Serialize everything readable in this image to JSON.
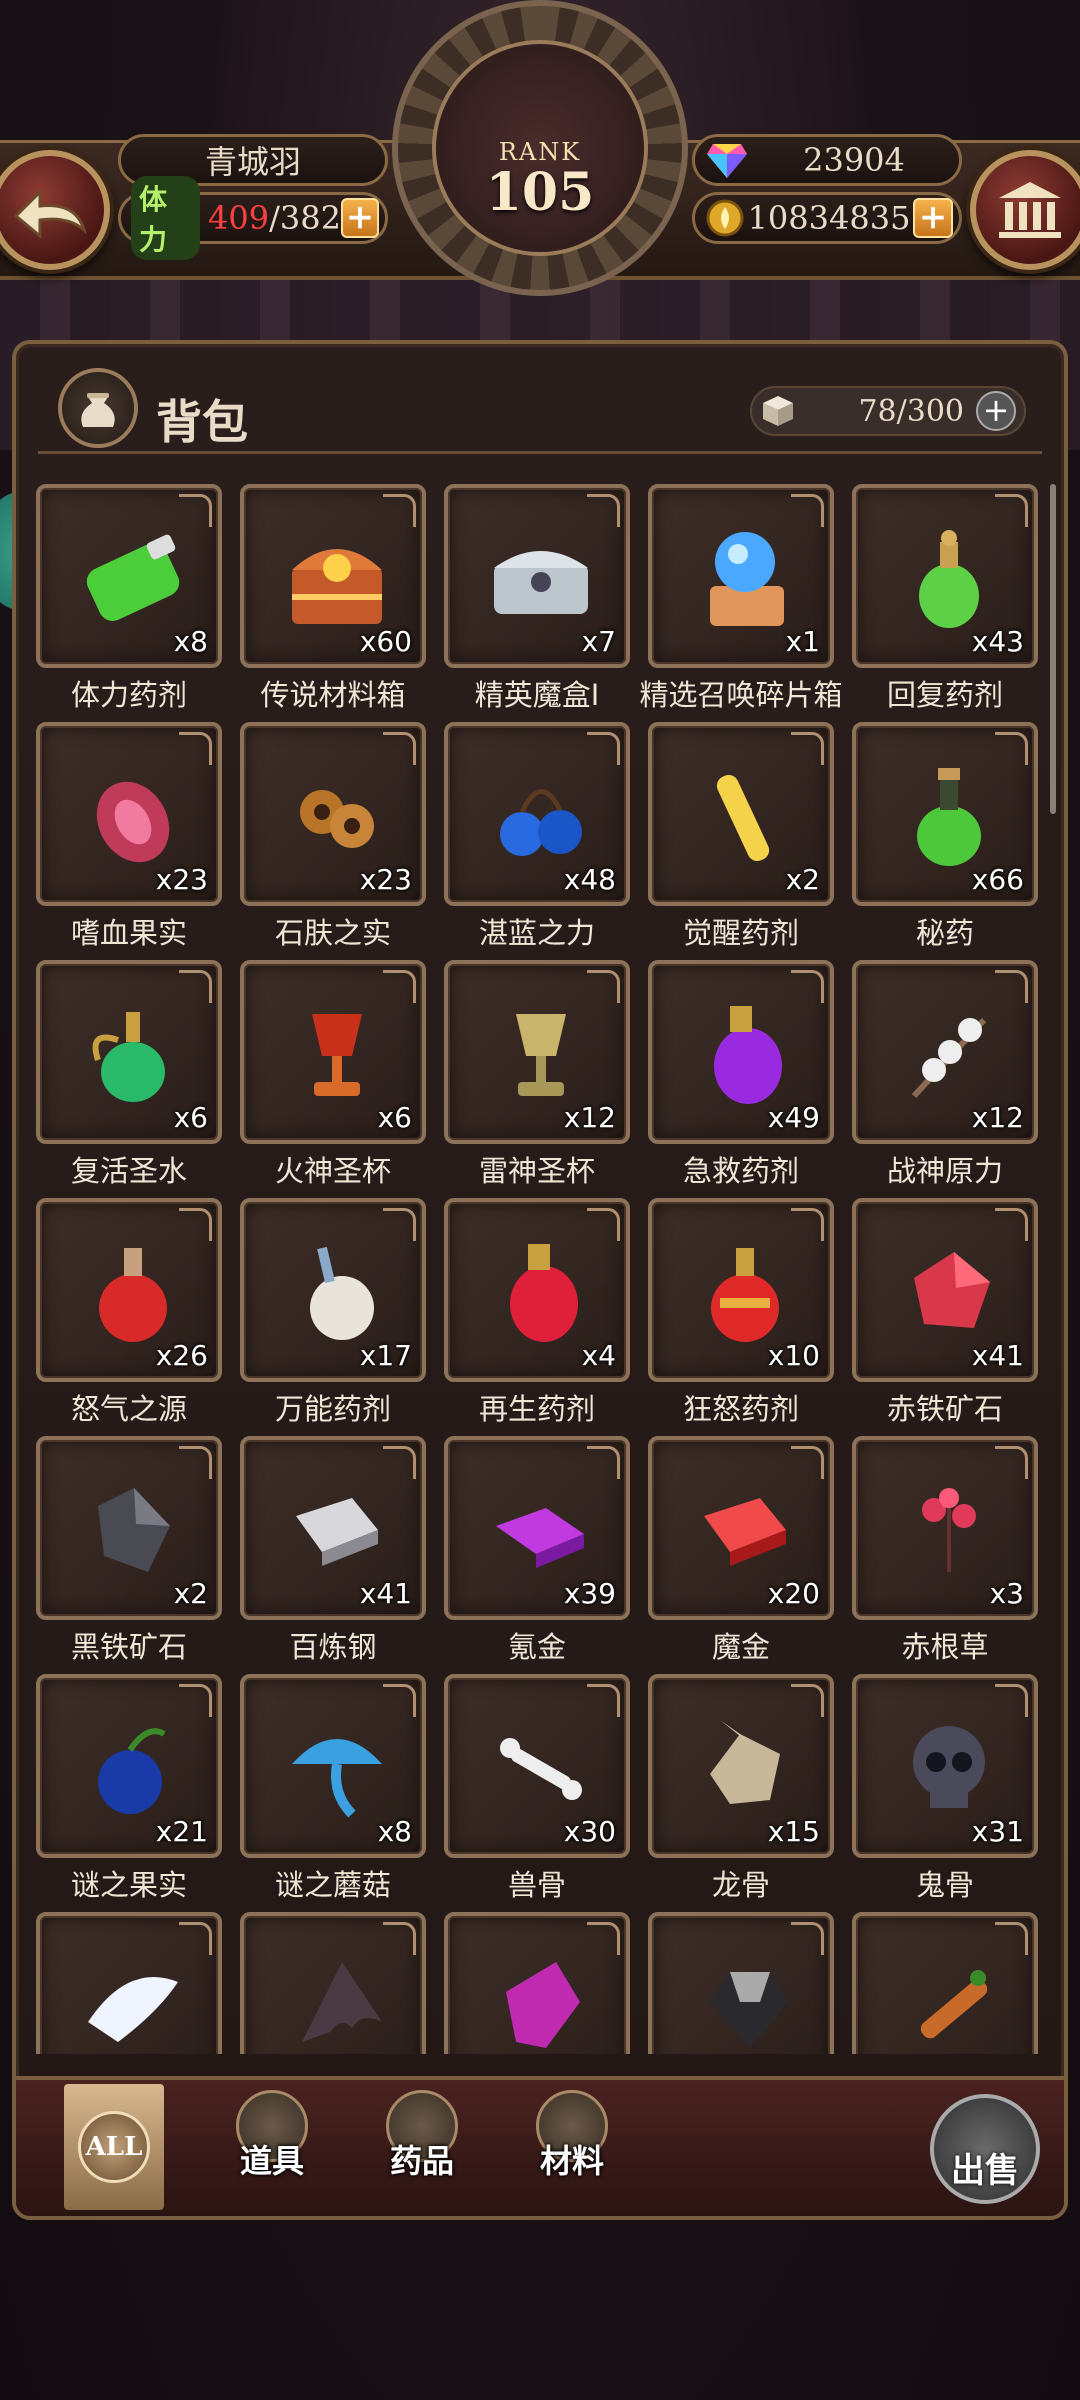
{
  "hud": {
    "player_name": "青城羽",
    "stamina_label": "体力",
    "stamina_current": "409",
    "stamina_max": "/382",
    "gems": "23904",
    "gold": "10834835",
    "rank_label": "RANK",
    "rank_value": "105"
  },
  "panel": {
    "title": "背包",
    "capacity": "78/300"
  },
  "items": [
    {
      "name": "体力药剂",
      "qty": "x8",
      "icon": "green-potion-bottle-icon"
    },
    {
      "name": "传说材料箱",
      "qty": "x60",
      "icon": "legendary-chest-icon"
    },
    {
      "name": "精英魔盒Ⅰ",
      "qty": "x7",
      "icon": "silver-chest-icon"
    },
    {
      "name": "精选召唤碎片箱",
      "qty": "x1",
      "icon": "summon-crystal-chest-icon"
    },
    {
      "name": "回复药剂",
      "qty": "x43",
      "icon": "green-vial-icon"
    },
    {
      "name": "嗜血果实",
      "qty": "x23",
      "icon": "blood-fruit-icon"
    },
    {
      "name": "石肤之实",
      "qty": "x23",
      "icon": "stone-nut-icon"
    },
    {
      "name": "湛蓝之力",
      "qty": "x48",
      "icon": "blue-berries-icon"
    },
    {
      "name": "觉醒药剂",
      "qty": "x2",
      "icon": "yellow-tube-icon"
    },
    {
      "name": "秘药",
      "qty": "x66",
      "icon": "green-flask-icon"
    },
    {
      "name": "复活圣水",
      "qty": "x6",
      "icon": "holy-water-icon"
    },
    {
      "name": "火神圣杯",
      "qty": "x6",
      "icon": "fire-chalice-icon"
    },
    {
      "name": "雷神圣杯",
      "qty": "x12",
      "icon": "thunder-chalice-icon"
    },
    {
      "name": "急救药剂",
      "qty": "x49",
      "icon": "purple-potion-icon"
    },
    {
      "name": "战神原力",
      "qty": "x12",
      "icon": "cotton-branch-icon"
    },
    {
      "name": "怒气之源",
      "qty": "x26",
      "icon": "red-round-flask-icon"
    },
    {
      "name": "万能药剂",
      "qty": "x17",
      "icon": "white-potion-icon"
    },
    {
      "name": "再生药剂",
      "qty": "x4",
      "icon": "red-potion-icon"
    },
    {
      "name": "狂怒药剂",
      "qty": "x10",
      "icon": "red-gold-flask-icon"
    },
    {
      "name": "赤铁矿石",
      "qty": "x41",
      "icon": "red-ore-icon"
    },
    {
      "name": "黑铁矿石",
      "qty": "x2",
      "icon": "black-ore-icon"
    },
    {
      "name": "百炼钢",
      "qty": "x41",
      "icon": "steel-ingot-icon"
    },
    {
      "name": "氪金",
      "qty": "x39",
      "icon": "purple-ingot-icon"
    },
    {
      "name": "魔金",
      "qty": "x20",
      "icon": "red-ingot-icon"
    },
    {
      "name": "赤根草",
      "qty": "x3",
      "icon": "red-herb-icon"
    },
    {
      "name": "谜之果实",
      "qty": "x21",
      "icon": "blue-fruit-icon"
    },
    {
      "name": "谜之蘑菇",
      "qty": "x8",
      "icon": "blue-mushroom-icon"
    },
    {
      "name": "兽骨",
      "qty": "x30",
      "icon": "bone-icon"
    },
    {
      "name": "龙骨",
      "qty": "x15",
      "icon": "dragon-skull-icon"
    },
    {
      "name": "鬼骨",
      "qty": "x31",
      "icon": "skull-icon"
    },
    {
      "name": "",
      "qty": "",
      "icon": "white-wing-icon"
    },
    {
      "name": "",
      "qty": "",
      "icon": "bat-wing-icon"
    },
    {
      "name": "",
      "qty": "",
      "icon": "purple-crystal-icon"
    },
    {
      "name": "",
      "qty": "",
      "icon": "black-gem-icon"
    },
    {
      "name": "",
      "qty": "",
      "icon": "wood-branch-icon"
    }
  ],
  "tabs": {
    "all": "ALL",
    "props": "道具",
    "potions": "药品",
    "materials": "材料",
    "sell": "出售"
  },
  "colors": {
    "frame_gold": "#8c7258",
    "stamina_over": "#ff4040",
    "plus_orange": "#f5b24a"
  }
}
